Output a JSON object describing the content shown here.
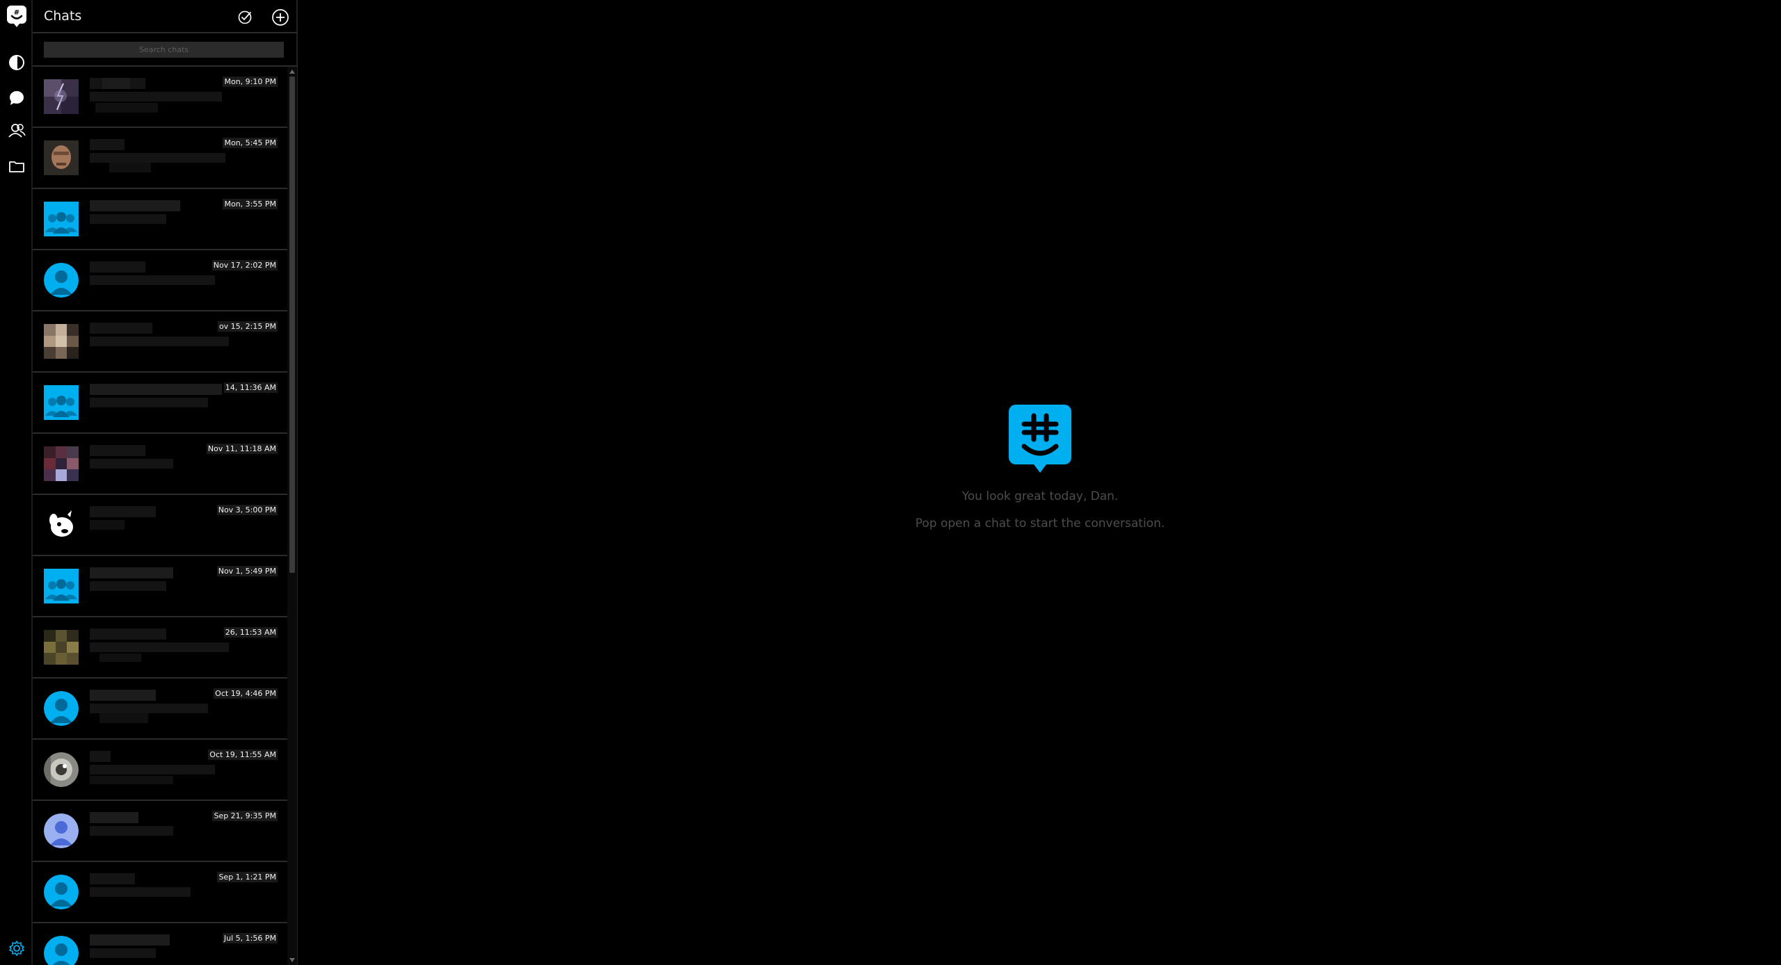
{
  "rail": {
    "icons": [
      "groupme-logo-icon",
      "discover-icon",
      "chat-bubble-icon",
      "contacts-icon",
      "folder-icon",
      "settings-icon"
    ]
  },
  "header": {
    "title": "Chats"
  },
  "search": {
    "placeholder": "Search chats"
  },
  "chats": [
    {
      "timestamp": "Mon, 9:10 PM",
      "avatar": "lightning-photo"
    },
    {
      "timestamp": "Mon, 5:45 PM",
      "avatar": "face-photo"
    },
    {
      "timestamp": "Mon, 3:55 PM",
      "avatar": "group-default"
    },
    {
      "timestamp": "Nov 17, 2:02 PM",
      "avatar": "person-default"
    },
    {
      "timestamp": "ov 15, 2:15 PM",
      "avatar": "pixelated-photo"
    },
    {
      "timestamp": "14, 11:36 AM",
      "avatar": "group-default"
    },
    {
      "timestamp": "Nov 11, 11:18 AM",
      "avatar": "pixelated-photo-dark"
    },
    {
      "timestamp": "Nov 3, 5:00 PM",
      "avatar": "cartoon-dog"
    },
    {
      "timestamp": "Nov 1, 5:49 PM",
      "avatar": "group-default"
    },
    {
      "timestamp": "26, 11:53 AM",
      "avatar": "pixelated-photo-olive"
    },
    {
      "timestamp": "Oct 19, 4:46 PM",
      "avatar": "person-default"
    },
    {
      "timestamp": "Oct 19, 11:55 AM",
      "avatar": "orb-photo"
    },
    {
      "timestamp": "Sep 21, 9:35 PM",
      "avatar": "person-purple"
    },
    {
      "timestamp": "Sep 1, 1:21 PM",
      "avatar": "person-default"
    },
    {
      "timestamp": "Jul 5, 1:56 PM",
      "avatar": "person-default"
    }
  ],
  "empty_state": {
    "line1": "You look great today, Dan.",
    "line2": "Pop open a chat to start the conversation."
  },
  "colors": {
    "accent": "#00aff0",
    "background": "#000000",
    "muted_text": "#4d4d4d"
  }
}
